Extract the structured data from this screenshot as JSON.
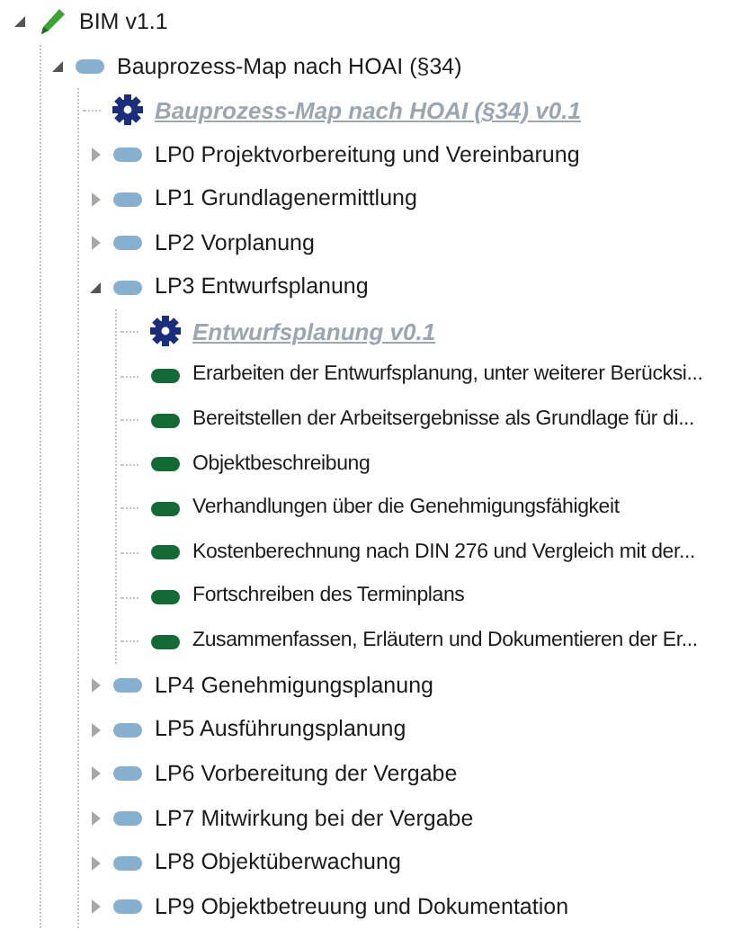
{
  "tree": [
    {
      "kind": "root",
      "label": "BIM v1.1",
      "expanded": true,
      "children": [
        {
          "kind": "phase",
          "label": "Bauprozess-Map nach HOAI (§34)",
          "expanded": true,
          "children": [
            {
              "kind": "version",
              "label": "Bauprozess-Map nach HOAI (§34) v0.1"
            },
            {
              "kind": "phase",
              "label": "LP0 Projektvorbereitung und Vereinbarung",
              "expanded": false
            },
            {
              "kind": "phase",
              "label": "LP1 Grundlagenermittlung",
              "expanded": false
            },
            {
              "kind": "phase",
              "label": "LP2 Vorplanung",
              "expanded": false
            },
            {
              "kind": "phase",
              "label": "LP3 Entwurfsplanung",
              "expanded": true,
              "children": [
                {
                  "kind": "version",
                  "label": "Entwurfsplanung v0.1"
                },
                {
                  "kind": "task",
                  "label": "Erarbeiten der Entwurfsplanung, unter weiterer Berücksi..."
                },
                {
                  "kind": "task",
                  "label": "Bereitstellen der Arbeitsergebnisse als Grundlage für di..."
                },
                {
                  "kind": "task",
                  "label": "Objektbeschreibung"
                },
                {
                  "kind": "task",
                  "label": "Verhandlungen über die Genehmigungsfähigkeit"
                },
                {
                  "kind": "task",
                  "label": "Kostenberechnung nach DIN 276 und Vergleich mit der..."
                },
                {
                  "kind": "task",
                  "label": "Fortschreiben des Terminplans"
                },
                {
                  "kind": "task",
                  "label": "Zusammenfassen, Erläutern und Dokumentieren der Er..."
                }
              ]
            },
            {
              "kind": "phase",
              "label": "LP4 Genehmigungsplanung",
              "expanded": false
            },
            {
              "kind": "phase",
              "label": "LP5 Ausführungsplanung",
              "expanded": false
            },
            {
              "kind": "phase",
              "label": "LP6 Vorbereitung der Vergabe",
              "expanded": false
            },
            {
              "kind": "phase",
              "label": "LP7 Mitwirkung bei der Vergabe",
              "expanded": false
            },
            {
              "kind": "phase",
              "label": "LP8 Objektüberwachung",
              "expanded": false
            },
            {
              "kind": "phase",
              "label": "LP9 Objektbetreuung und Dokumentation",
              "expanded": false
            }
          ]
        }
      ]
    }
  ]
}
